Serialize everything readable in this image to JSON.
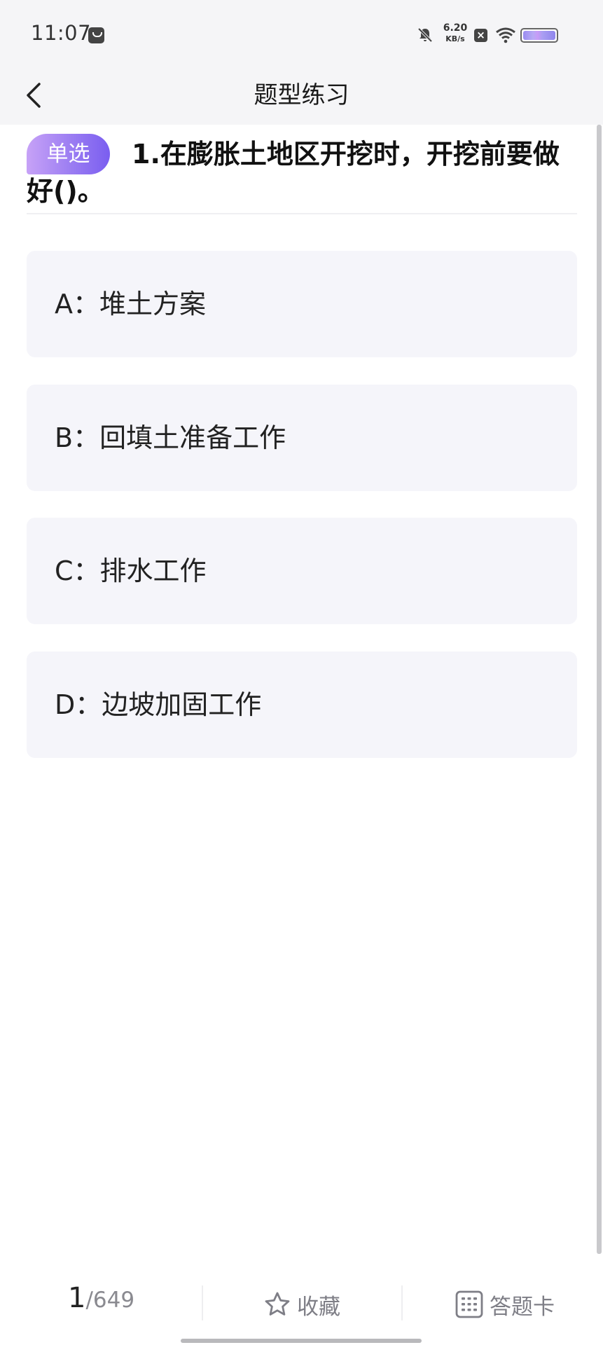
{
  "status_bar": {
    "time": "11:07",
    "net_speed_value": "6.20",
    "net_speed_unit": "KB/s",
    "icons": [
      "message-icon",
      "mute-icon",
      "close-notification-icon",
      "wifi-icon",
      "battery-icon"
    ]
  },
  "header": {
    "title": "题型练习"
  },
  "question": {
    "type_badge": "单选",
    "text": "1.在膨胀土地区开挖时，开挖前要做好()。",
    "options": [
      {
        "text": "A：堆土方案"
      },
      {
        "text": "B：回填土准备工作"
      },
      {
        "text": "C：排水工作"
      },
      {
        "text": "D：边坡加固工作"
      }
    ]
  },
  "bottom_bar": {
    "current": "1",
    "total": "/649",
    "favorite_label": "收藏",
    "answer_card_label": "答题卡"
  },
  "colors": {
    "badge_start": "#c7a2f7",
    "badge_end": "#7a5ef0",
    "option_bg": "#f5f5fa",
    "header_bg": "#f5f5f7"
  }
}
